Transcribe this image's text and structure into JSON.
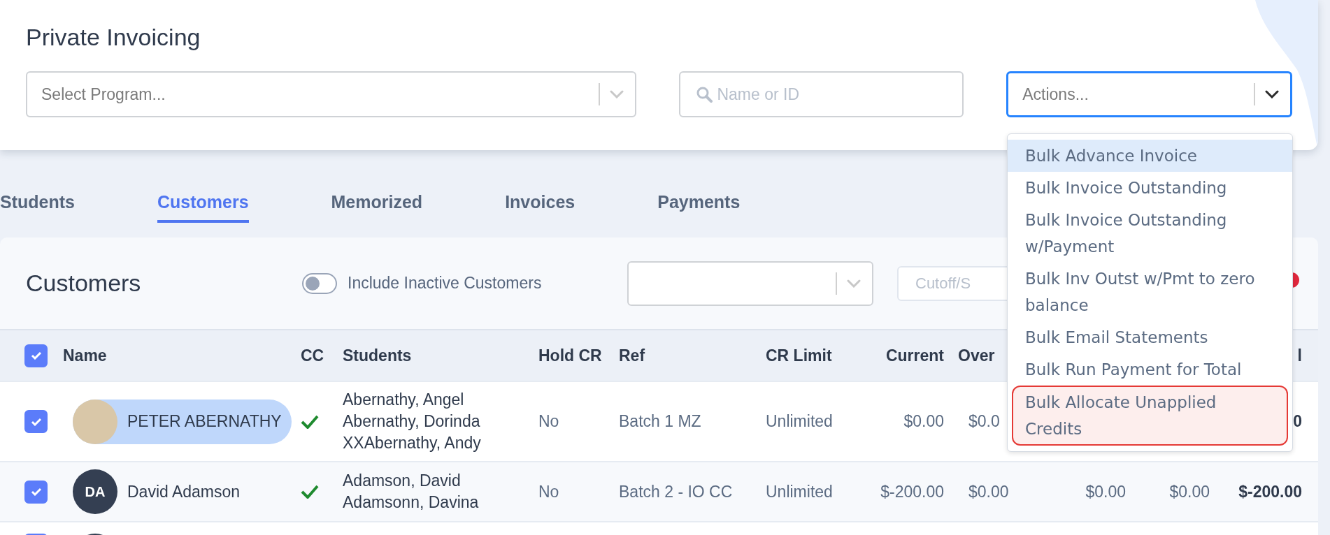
{
  "header": {
    "title": "Private Invoicing",
    "program_select": {
      "placeholder": "Select Program..."
    },
    "search": {
      "placeholder": "Name or ID"
    },
    "actions": {
      "placeholder": "Actions...",
      "focused": true,
      "menu": [
        {
          "label": "Bulk Advance Invoice",
          "highlighted": true,
          "circled": false
        },
        {
          "label": "Bulk Invoice Outstanding",
          "highlighted": false,
          "circled": false
        },
        {
          "label": "Bulk Invoice Outstanding w/Payment",
          "highlighted": false,
          "circled": false
        },
        {
          "label": "Bulk Inv Outst w/Pmt to zero balance",
          "highlighted": false,
          "circled": false
        },
        {
          "label": "Bulk Email Statements",
          "highlighted": false,
          "circled": false
        },
        {
          "label": "Bulk Run Payment for Total",
          "highlighted": false,
          "circled": false
        },
        {
          "label": "Bulk Allocate Unapplied Credits",
          "highlighted": false,
          "circled": true
        }
      ]
    }
  },
  "tabs": [
    {
      "label": "Students",
      "selected": false
    },
    {
      "label": "Customers",
      "selected": true
    },
    {
      "label": "Memorized",
      "selected": false
    },
    {
      "label": "Invoices",
      "selected": false
    },
    {
      "label": "Payments",
      "selected": false
    }
  ],
  "panel": {
    "title": "Customers",
    "toggle": {
      "label": "Include Inactive Customers",
      "on": false
    },
    "cutoff_field": {
      "placeholder": "Cutoff/S"
    }
  },
  "table": {
    "all_checked": true,
    "columns": [
      "Name",
      "CC",
      "Students",
      "Hold CR",
      "Ref",
      "CR Limit",
      "Current",
      "Over",
      "l"
    ],
    "rows": [
      {
        "checked": true,
        "avatar": {
          "kind": "photo"
        },
        "name": "PETER ABERNATHY",
        "highlighted": true,
        "cc": true,
        "students": [
          "Abernathy, Angel",
          "Abernathy, Dorinda",
          "XXAbernathy, Andy"
        ],
        "hold_cr": "No",
        "ref": "Batch 1 MZ",
        "cr_limit": "Unlimited",
        "current": "$0.00",
        "column_8": "$0.0",
        "column_11": "0"
      },
      {
        "checked": true,
        "avatar": {
          "kind": "initials",
          "initials": "DA"
        },
        "name": "David Adamson",
        "highlighted": false,
        "cc": true,
        "students": [
          "Adamson, David",
          "Adamsonn, Davina"
        ],
        "hold_cr": "No",
        "ref": "Batch 2 - IO CC",
        "cr_limit": "Unlimited",
        "current": "$-200.00",
        "column_8": "$0.00",
        "column_9": "$0.00",
        "column_10": "$0.00",
        "column_11": "$-200.00"
      },
      {
        "checked": true,
        "avatar": {
          "kind": "initials"
        }
      }
    ]
  }
}
